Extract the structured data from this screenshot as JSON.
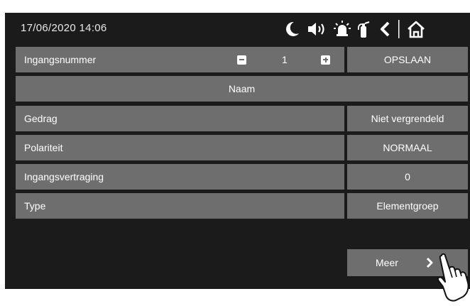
{
  "status_bar": {
    "datetime": "17/06/2020 14:06",
    "icons": [
      "moon-icon",
      "speaker-icon",
      "alarm-siren-icon",
      "fire-extinguisher-icon",
      "back-icon",
      "home-icon"
    ]
  },
  "input_row": {
    "label": "Ingangsnummer",
    "value": "1",
    "save_label": "OPSLAAN"
  },
  "name_row": {
    "label": "Naam"
  },
  "settings": [
    {
      "label": "Gedrag",
      "value": "Niet vergrendeld"
    },
    {
      "label": "Polariteit",
      "value": "NORMAAL"
    },
    {
      "label": "Ingangsvertraging",
      "value": "0"
    },
    {
      "label": "Type",
      "value": "Elementgroep"
    }
  ],
  "more_button": {
    "label": "Meer"
  },
  "colors": {
    "background": "#1b1b1b",
    "panel": "#6e6e6e",
    "text": "#ffffff"
  }
}
